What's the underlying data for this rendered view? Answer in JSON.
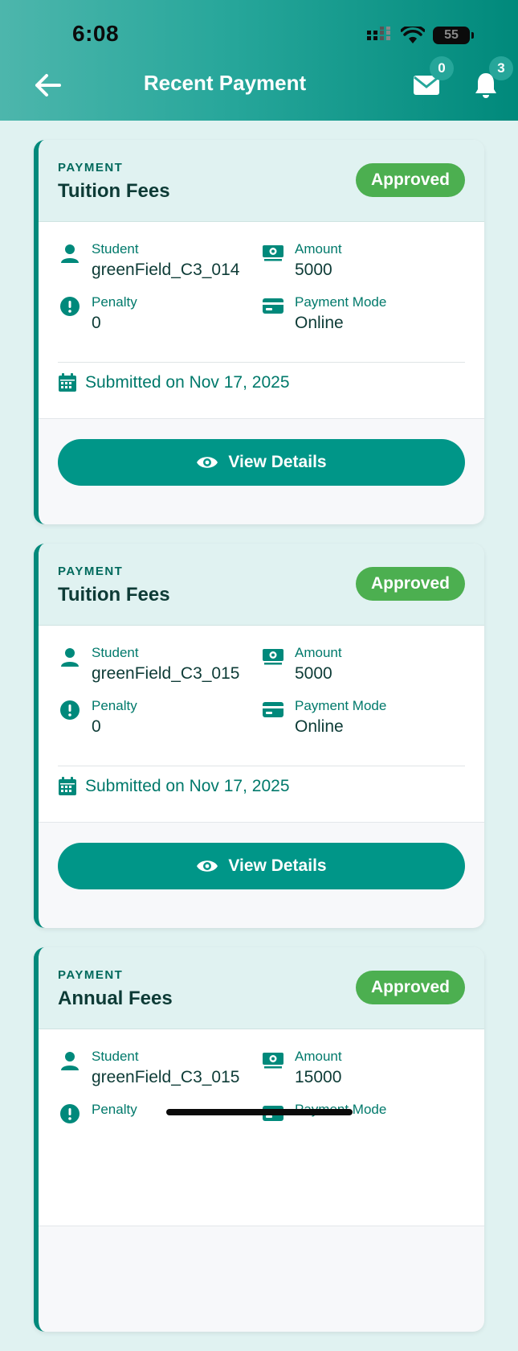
{
  "status_bar": {
    "time": "6:08",
    "battery": "55"
  },
  "header": {
    "title": "Recent Payment",
    "mail_count": "0",
    "notification_count": "3"
  },
  "colors": {
    "primary": "#009688",
    "approved": "#4caf50",
    "accent_text": "#00796b"
  },
  "labels": {
    "kind": "PAYMENT",
    "student": "Student",
    "amount": "Amount",
    "penalty": "Penalty",
    "payment_mode": "Payment Mode",
    "view_details": "View Details"
  },
  "payments": [
    {
      "title": "Tuition Fees",
      "status": "Approved",
      "student": "greenField_C3_014",
      "amount": "5000",
      "penalty": "0",
      "mode": "Online",
      "submitted": "Submitted on Nov 17, 2025"
    },
    {
      "title": "Tuition Fees",
      "status": "Approved",
      "student": "greenField_C3_015",
      "amount": "5000",
      "penalty": "0",
      "mode": "Online",
      "submitted": "Submitted on Nov 17, 2025"
    },
    {
      "title": "Annual Fees",
      "status": "Approved",
      "student": "greenField_C3_015",
      "amount": "15000",
      "penalty": "",
      "mode": "",
      "submitted": ""
    }
  ]
}
